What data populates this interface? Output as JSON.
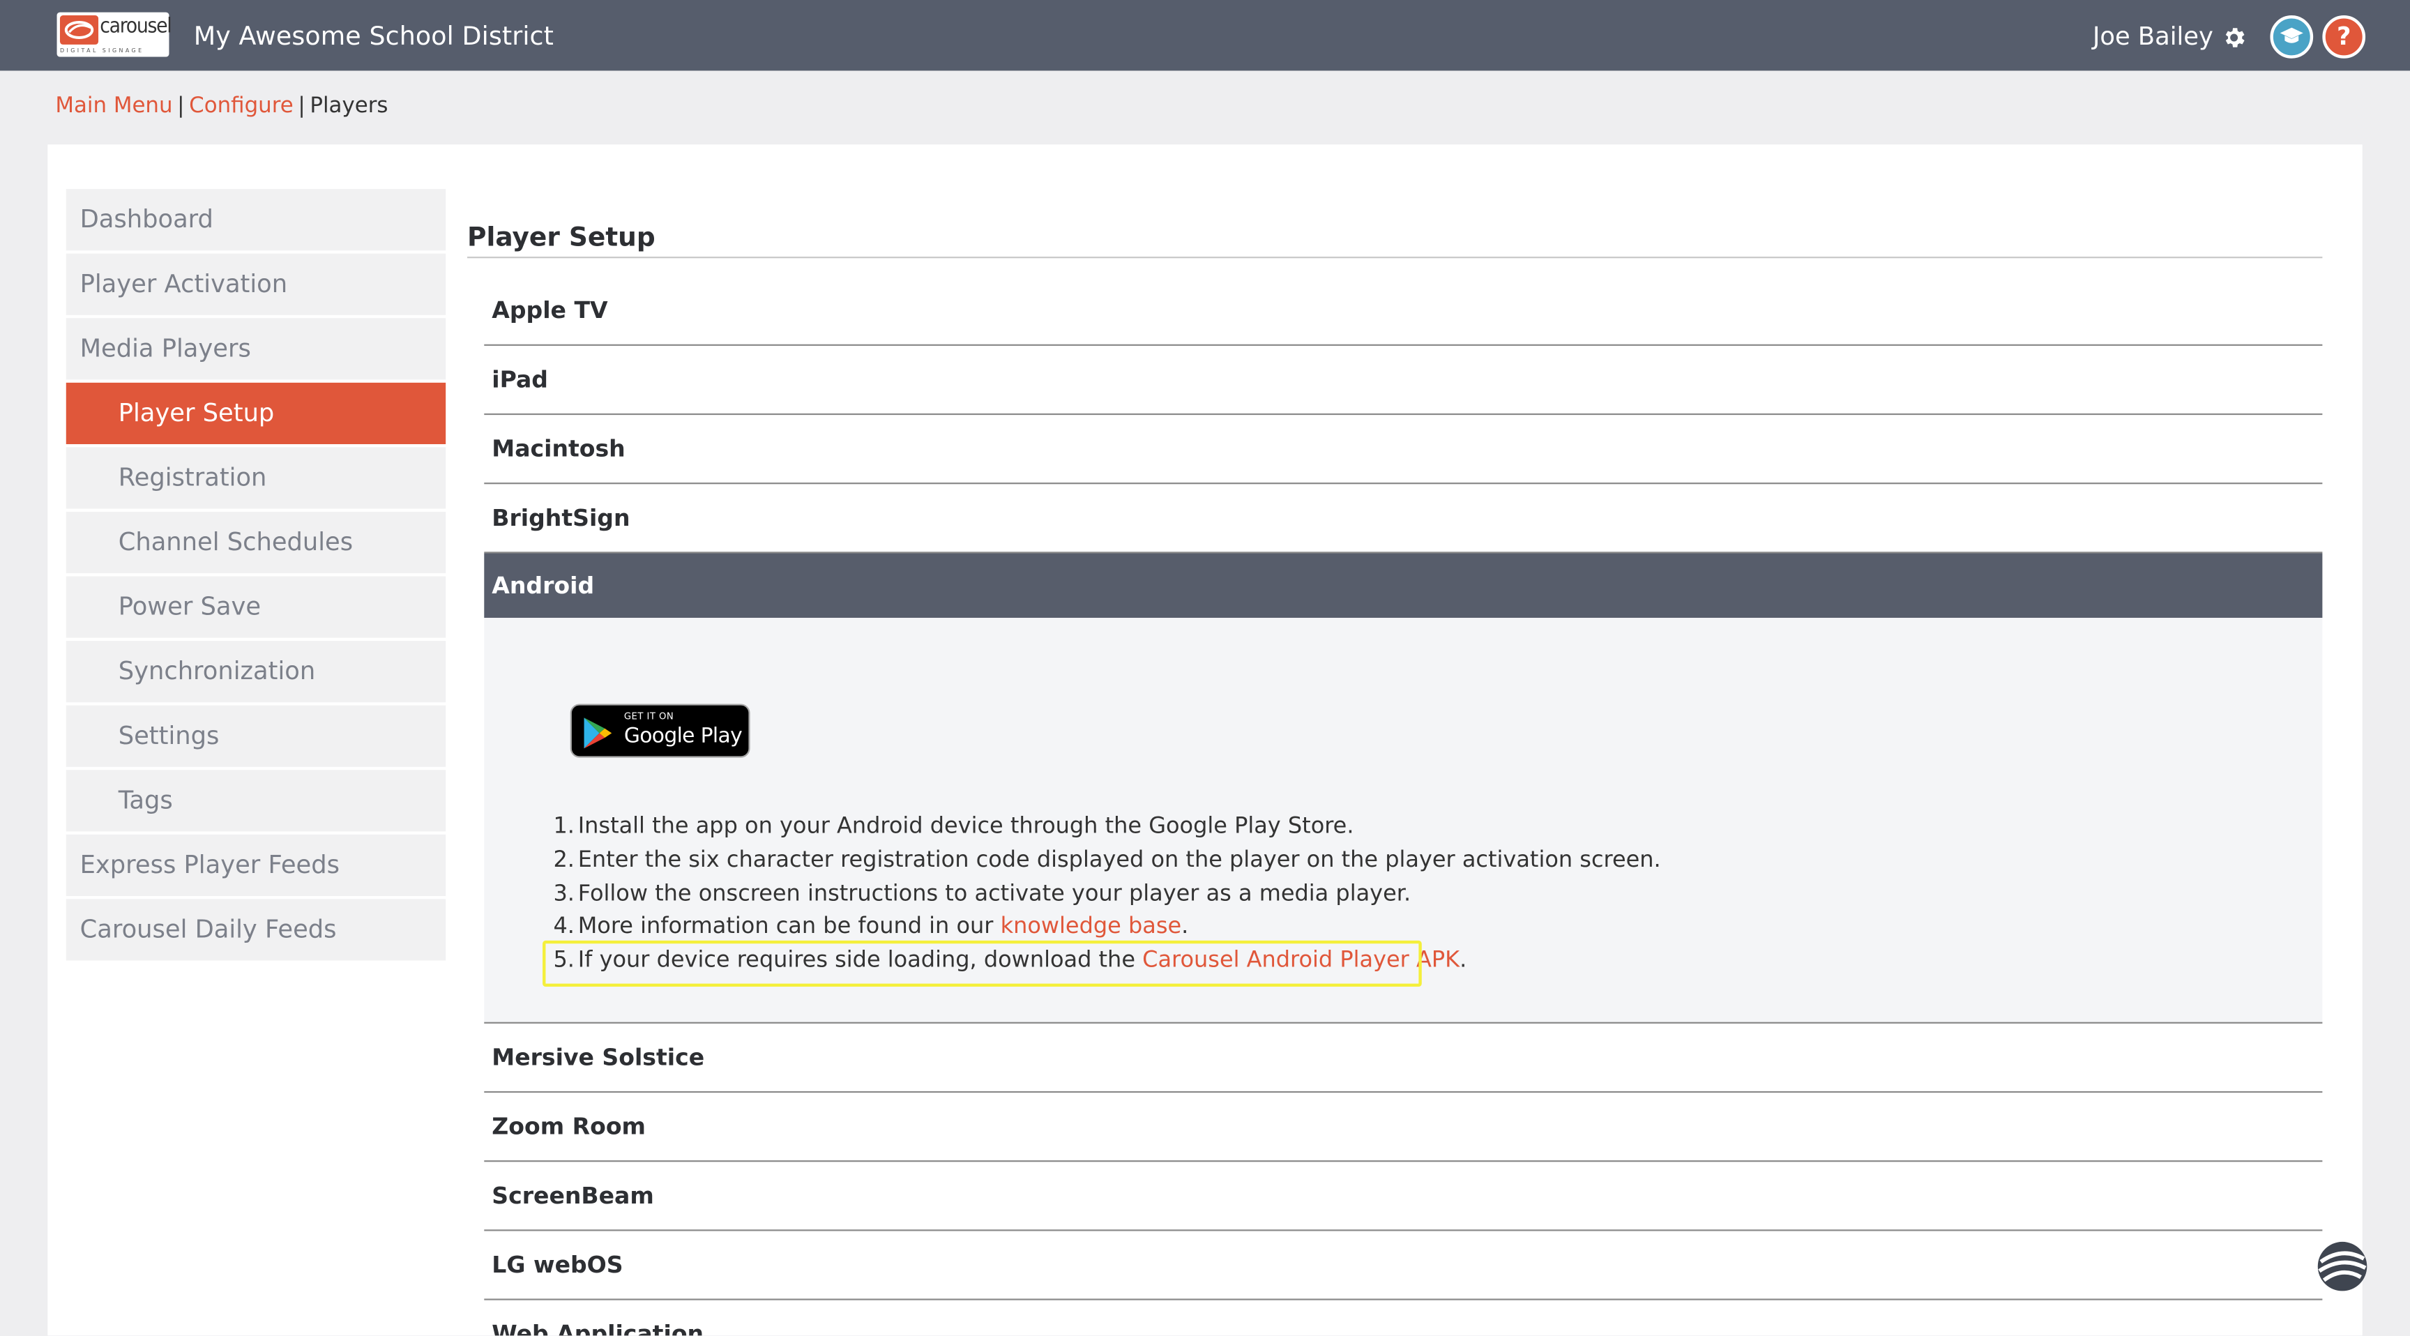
{
  "header": {
    "logo_word": "carousel",
    "logo_tagline": "DIGITAL SIGNAGE",
    "title": "My Awesome School District",
    "user_name": "Joe Bailey",
    "help_label": "?"
  },
  "breadcrumb": {
    "main_menu": "Main Menu",
    "configure": "Configure",
    "current": "Players",
    "separator": "|"
  },
  "sidebar": {
    "items": [
      {
        "label": "Dashboard"
      },
      {
        "label": "Player Activation"
      },
      {
        "label": "Media Players"
      },
      {
        "label": "Player Setup"
      },
      {
        "label": "Registration"
      },
      {
        "label": "Channel Schedules"
      },
      {
        "label": "Power Save"
      },
      {
        "label": "Synchronization"
      },
      {
        "label": "Settings"
      },
      {
        "label": "Tags"
      },
      {
        "label": "Express Player Feeds"
      },
      {
        "label": "Carousel Daily Feeds"
      }
    ],
    "active_item": "Player Setup"
  },
  "main": {
    "section_title": "Player Setup",
    "accordion_items": [
      {
        "label": "Apple TV"
      },
      {
        "label": "iPad"
      },
      {
        "label": "Macintosh"
      },
      {
        "label": "BrightSign"
      },
      {
        "label": "Android"
      },
      {
        "label": "Mersive Solstice"
      },
      {
        "label": "Zoom Room"
      },
      {
        "label": "ScreenBeam"
      },
      {
        "label": "LG webOS"
      },
      {
        "label": "Web Application"
      }
    ],
    "expanded_item": "Android",
    "google_play_badge": {
      "small_text": "GET IT ON",
      "big_text": "Google Play"
    },
    "steps": [
      {
        "num": "1.",
        "text": "Install the app on your Android device through the Google Play Store."
      },
      {
        "num": "2.",
        "text": "Enter the six character registration code displayed on the player on the player activation screen."
      },
      {
        "num": "3.",
        "text": "Follow the onscreen instructions to activate your player as a media player."
      },
      {
        "num": "4.",
        "text": "More information can be found in our ",
        "link": "knowledge base",
        "after": "."
      },
      {
        "num": "5.",
        "text": "If your device requires side loading, download the ",
        "link": "Carousel Android Player APK",
        "after": "."
      }
    ]
  },
  "colors": {
    "header_bg": "#565d6c",
    "accent": "#e0573a",
    "highlight": "#f4ef3b",
    "nav_bg": "#f1f1f2",
    "open_panel_bg": "#f4f5f7"
  }
}
